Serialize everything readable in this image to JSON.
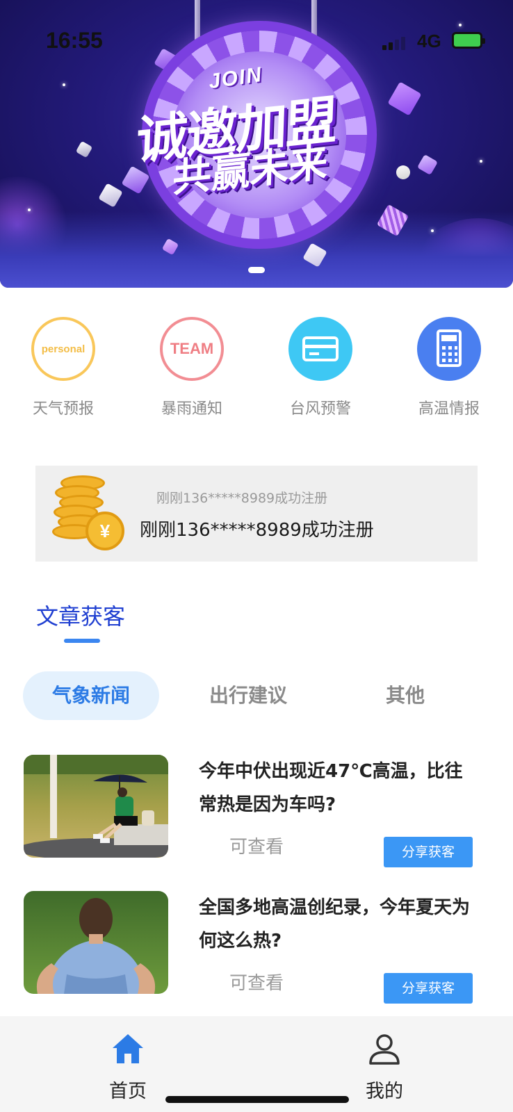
{
  "status_bar": {
    "time": "16:55",
    "network": "4G"
  },
  "banner": {
    "join": "JOIN",
    "line1": "诚邀加盟",
    "line2": "共赢未来"
  },
  "quick_menu": [
    {
      "label": "天气预报",
      "icon": "personal-seal-icon",
      "icon_text": "personal",
      "color": "#f9c75a"
    },
    {
      "label": "暴雨通知",
      "icon": "team-seal-icon",
      "icon_text": "TEAM",
      "color": "#f28d93"
    },
    {
      "label": "台风预警",
      "icon": "credit-card-icon",
      "color": "#3ec8f4"
    },
    {
      "label": "高温情报",
      "icon": "calculator-icon",
      "color": "#4a7ff0"
    }
  ],
  "notice": {
    "coin_symbol": "¥",
    "previous": "刚刚136*****8989成功注册",
    "current": "刚刚136*****8989成功注册"
  },
  "section": {
    "title": "文章获客"
  },
  "tabs": [
    {
      "label": "气象新闻",
      "active": true
    },
    {
      "label": "出行建议",
      "active": false
    },
    {
      "label": "其他",
      "active": false
    }
  ],
  "articles": [
    {
      "title": "今年中伏出现近47℃高温，比往常热是因为车吗?",
      "status": "可查看",
      "action": "分享获客"
    },
    {
      "title": "全国多地高温创纪录，今年夏天为何这么热?",
      "status": "可查看",
      "action": "分享获客"
    }
  ],
  "bottom_nav": [
    {
      "label": "首页",
      "icon": "home-icon",
      "active": true
    },
    {
      "label": "我的",
      "icon": "user-icon",
      "active": false
    }
  ],
  "colors": {
    "accent": "#2c7be5",
    "share_button": "#3b97f5",
    "title_blue": "#1f3fd1"
  }
}
